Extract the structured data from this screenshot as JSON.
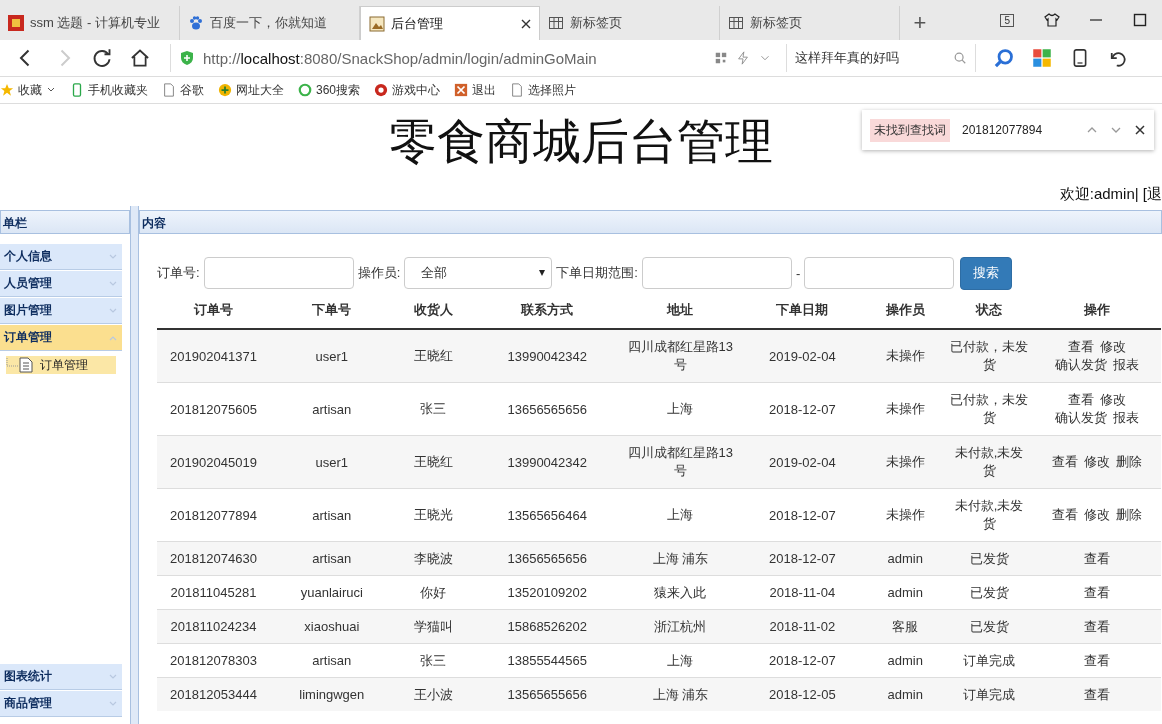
{
  "browser": {
    "tabs": [
      {
        "label": "ssm 选题 - 计算机专业",
        "selected": false
      },
      {
        "label": "百度一下，你就知道",
        "selected": false
      },
      {
        "label": "后台管理",
        "selected": true
      },
      {
        "label": "新标签页",
        "selected": false
      },
      {
        "label": "新标签页",
        "selected": false
      }
    ],
    "new_tab": "+",
    "tab_count": "5",
    "url": "http://**localhost**:8080/SnackShop/admin/login/adminGoMain",
    "search_box": "这样拜年真的好吗",
    "bookmarks": [
      "收藏",
      "手机收藏夹",
      "谷歌",
      "网址大全",
      "360搜索",
      "游戏中心",
      "退出",
      "选择照片"
    ]
  },
  "header": {
    "title": "零食商城后台管理",
    "find_bar": {
      "status": "未找到查找词",
      "query": "201812077894"
    },
    "welcome": "欢迎:admin| [退"
  },
  "sidebar": {
    "title": "单栏",
    "items": [
      {
        "label": "个人信息",
        "selected": false,
        "expanded": false
      },
      {
        "label": "人员管理",
        "selected": false,
        "expanded": false
      },
      {
        "label": "图片管理",
        "selected": false,
        "expanded": false
      },
      {
        "label": "订单管理",
        "selected": true,
        "expanded": true,
        "children": [
          {
            "label": "订单管理",
            "selected": true
          }
        ]
      }
    ],
    "bottom_items": [
      {
        "label": "图表统计",
        "selected": false,
        "expanded": false
      },
      {
        "label": "商品管理",
        "selected": false,
        "expanded": false
      }
    ]
  },
  "content": {
    "title": "内容",
    "filters": {
      "order_label": "订单号:",
      "operator_label": "操作员:",
      "operator_value": "全部",
      "date_label": "下单日期范围:",
      "date_separator": "-",
      "search_button": "搜索"
    },
    "table": {
      "columns": [
        "订单号",
        "下单号",
        "收货人",
        "联系方式",
        "地址",
        "下单日期",
        "操作员",
        "状态",
        "操作"
      ],
      "rows": [
        {
          "cells": [
            "201902041371",
            "user1",
            "王晓红",
            "13990042342",
            "四川成都红星路13号",
            "2019-02-04",
            "未操作",
            "已付款，未发货"
          ],
          "actions": [
            "查看",
            "修改",
            "确认发货",
            "报表"
          ]
        },
        {
          "cells": [
            "201812075605",
            "artisan",
            "张三",
            "13656565656",
            "上海",
            "2018-12-07",
            "未操作",
            "已付款，未发货"
          ],
          "actions": [
            "查看",
            "修改",
            "确认发货",
            "报表"
          ]
        },
        {
          "cells": [
            "201902045019",
            "user1",
            "王晓红",
            "13990042342",
            "四川成都红星路13号",
            "2019-02-04",
            "未操作",
            "未付款,未发货"
          ],
          "actions": [
            "查看",
            "修改",
            "删除"
          ]
        },
        {
          "cells": [
            "201812077894",
            "artisan",
            "王晓光",
            "13565656464",
            "上海",
            "2018-12-07",
            "未操作",
            "未付款,未发货"
          ],
          "actions": [
            "查看",
            "修改",
            "删除"
          ]
        },
        {
          "cells": [
            "201812074630",
            "artisan",
            "李晓波",
            "13656565656",
            "上海 浦东",
            "2018-12-07",
            "admin",
            "已发货"
          ],
          "actions": [
            "查看"
          ]
        },
        {
          "cells": [
            "201811045281",
            "yuanlairuci",
            "你好",
            "13520109202",
            "猿来入此",
            "2018-11-04",
            "admin",
            "已发货"
          ],
          "actions": [
            "查看"
          ]
        },
        {
          "cells": [
            "201811024234",
            "xiaoshuai",
            "学猫叫",
            "15868526202",
            "浙江杭州",
            "2018-11-02",
            "客服",
            "已发货"
          ],
          "actions": [
            "查看"
          ]
        },
        {
          "cells": [
            "201812078303",
            "artisan",
            "张三",
            "13855544565",
            "上海",
            "2018-12-07",
            "admin",
            "订单完成"
          ],
          "actions": [
            "查看"
          ]
        },
        {
          "cells": [
            "201812053444",
            "limingwgen",
            "王小波",
            "13565655656",
            "上海 浦东",
            "2018-12-05",
            "admin",
            "订单完成"
          ],
          "actions": [
            "查看"
          ]
        }
      ]
    }
  }
}
